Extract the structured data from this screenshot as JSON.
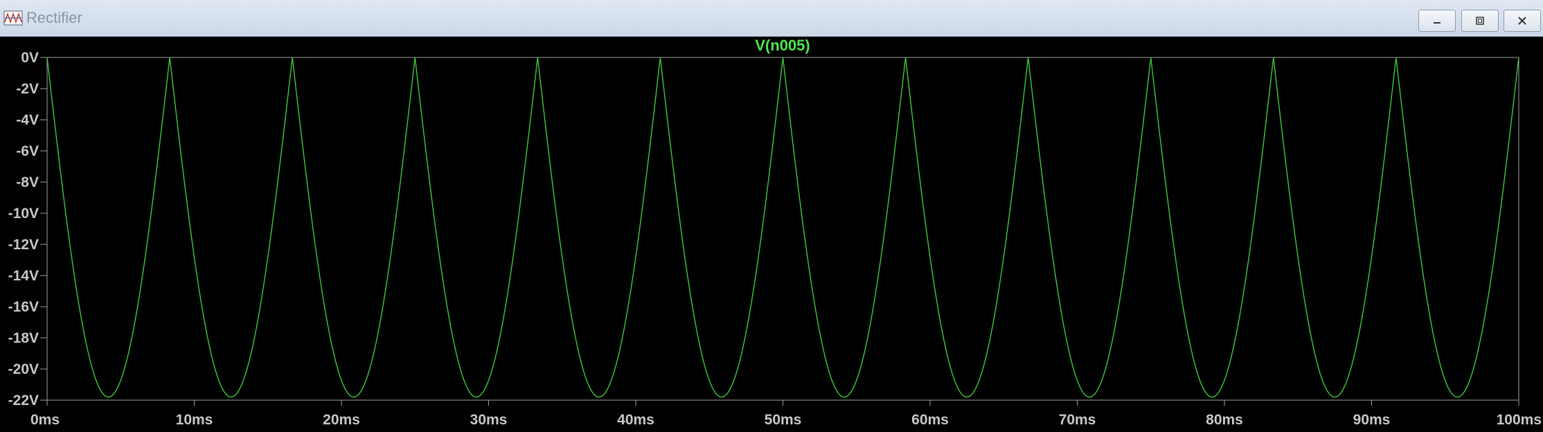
{
  "window": {
    "title": "Rectifier",
    "controls": {
      "minimize": "minimize",
      "maximize": "maximize",
      "close": "close"
    }
  },
  "colors": {
    "background": "#000000",
    "trace": "#3fc93f",
    "axis_text": "#c8c8c8",
    "frame": "#a0a0a0",
    "title_text": "#4de84d"
  },
  "chart_data": {
    "type": "line",
    "title": "V(n005)",
    "xlabel": "",
    "ylabel": "",
    "x_unit": "ms",
    "y_unit": "V",
    "xlim": [
      0,
      100
    ],
    "ylim": [
      -22,
      0
    ],
    "grid": false,
    "x_ticks": [
      "0ms",
      "10ms",
      "20ms",
      "30ms",
      "40ms",
      "50ms",
      "60ms",
      "70ms",
      "80ms",
      "90ms",
      "100ms"
    ],
    "y_ticks": [
      "0V",
      "-2V",
      "-4V",
      "-6V",
      "-8V",
      "-10V",
      "-12V",
      "-14V",
      "-16V",
      "-18V",
      "-20V",
      "-22V"
    ],
    "series": [
      {
        "name": "V(n005)",
        "waveform": "full-wave rectified sine (negative)",
        "frequency_hz": 60,
        "peak_v": -21.8,
        "period_ms": 8.333
      }
    ]
  }
}
